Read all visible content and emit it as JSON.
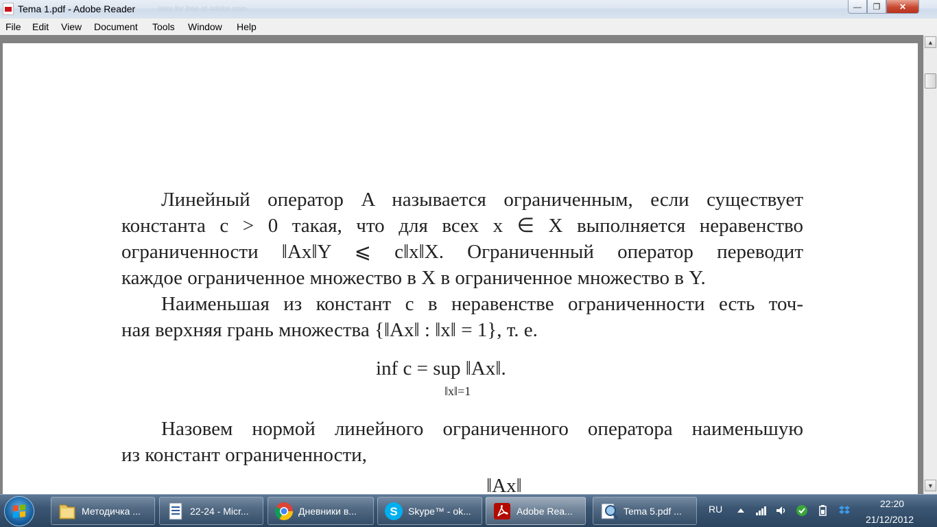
{
  "window": {
    "title": "Tema 1.pdf - Adobe Reader",
    "ghost_text": "Inter for free at adobe.com",
    "buttons": {
      "minimize": "—",
      "maximize": "❐",
      "close": "✕"
    }
  },
  "menu": [
    "File",
    "Edit",
    "View",
    "Document",
    "Tools",
    "Window",
    "Help"
  ],
  "document": {
    "para1": [
      "Линейный оператор A называется ограниченным, если существует",
      "константа c > 0 такая, что для всех x ∈ X выполняется неравенство",
      "ограниченности ‖Ax‖Y ⩽ c‖x‖X. Ограниченный оператор переводит",
      "каждое ограниченное множество в X в ограниченное множество в Y."
    ],
    "para2": [
      "Наименьшая из констант c в неравенстве ограниченности есть точ-",
      "ная верхняя грань множества {‖Ax‖ : ‖x‖ = 1}, т. е."
    ],
    "formula1": "inf c = sup ‖Ax‖.",
    "formula1_sub": "‖x‖=1",
    "para3": [
      "Назовем нормой линейного ограниченного оператора наименьшую",
      "из констант ограниченности,"
    ],
    "formula2_partial": "‖Ax‖"
  },
  "scrollbar": {
    "up": "▲",
    "down": "▼"
  },
  "taskbar": {
    "items": [
      {
        "label": "Методичка ...",
        "icon": "folder-icon"
      },
      {
        "label": "22-24 - Micr...",
        "icon": "word-document-icon"
      },
      {
        "label": "Дневники в...",
        "icon": "chrome-icon"
      },
      {
        "label": "Skype™ - ok...",
        "icon": "skype-icon"
      },
      {
        "label": "Adobe Rea...",
        "icon": "adobe-reader-icon",
        "active": true
      },
      {
        "label": "Tema 5.pdf ...",
        "icon": "pdf-magnifier-icon"
      }
    ],
    "tray": {
      "language": "RU",
      "time": "22:20",
      "date": "21/12/2012"
    }
  }
}
